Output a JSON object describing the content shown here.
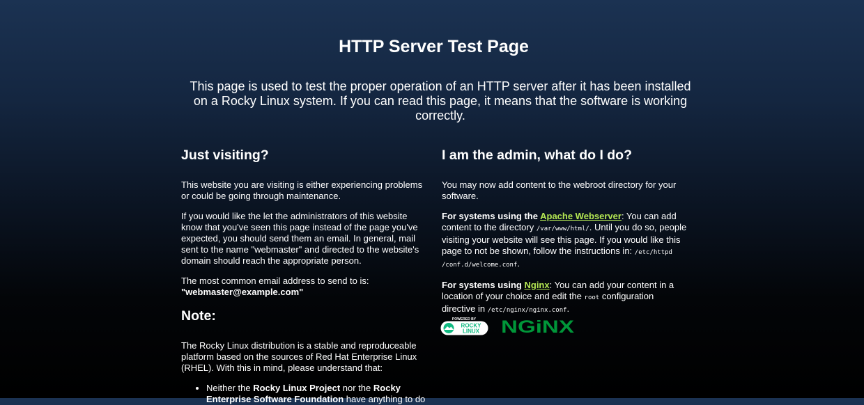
{
  "page": {
    "title": "HTTP Server Test Page",
    "intro": "This page is used to test the proper operation of an HTTP server after it has been installed on a Rocky Linux system. If you can read this page, it means that the software is working correctly."
  },
  "left": {
    "heading": "Just visiting?",
    "p1": "This website you are visiting is either experiencing problems or could be going through maintenance.",
    "p2": "If you would like the let the administrators of this website know that you've seen this page instead of the page you've expected, you should send them an email. In general, mail sent to the name \"webmaster\" and directed to the website's domain should reach the appropriate person.",
    "p3_text": "The most common email address to send to is:",
    "p3_email": "\"webmaster@example.com\"",
    "note_heading": "Note:",
    "note_p": "The Rocky Linux distribution is a stable and reproduceable platform based on the sources of Red Hat Enterprise Linux (RHEL). With this in mind, please understand that:",
    "bullet": {
      "t1": "Neither the ",
      "b1": "Rocky Linux Project",
      "t2": " nor the ",
      "b2": "Rocky Enterprise Software Foundation",
      "t3": " have anything to do"
    }
  },
  "right": {
    "heading": "I am the admin, what do I do?",
    "p1": "You may now add content to the webroot directory for your software.",
    "apache": {
      "label_prefix": "For systems using the ",
      "link": "Apache Webserver",
      "text1": ": You can add content to the directory ",
      "code1": "/var/www/html/",
      "text2": ". Until you do so, people visiting your website will see this page. If you would like this page to not be shown, follow the instructions in: ",
      "code2": "/etc/httpd /conf.d/welcome.conf",
      "text3": "."
    },
    "nginx": {
      "label_prefix": "For systems using ",
      "link": "Nginx",
      "text1": ": You can add your content in a location of your choice and edit the ",
      "code1": "root",
      "text2": " configuration directive in ",
      "code2": "/etc/nginx/nginx.conf",
      "text3": "."
    }
  },
  "logos": {
    "rocky_powered": "POWERED BY",
    "rocky_line1": "ROCKY",
    "rocky_line2": "LINUX",
    "nginx": "NGiNX",
    "rocky_green": "#10b981",
    "nginx_green": "#009639",
    "link_color": "#b5e853"
  }
}
